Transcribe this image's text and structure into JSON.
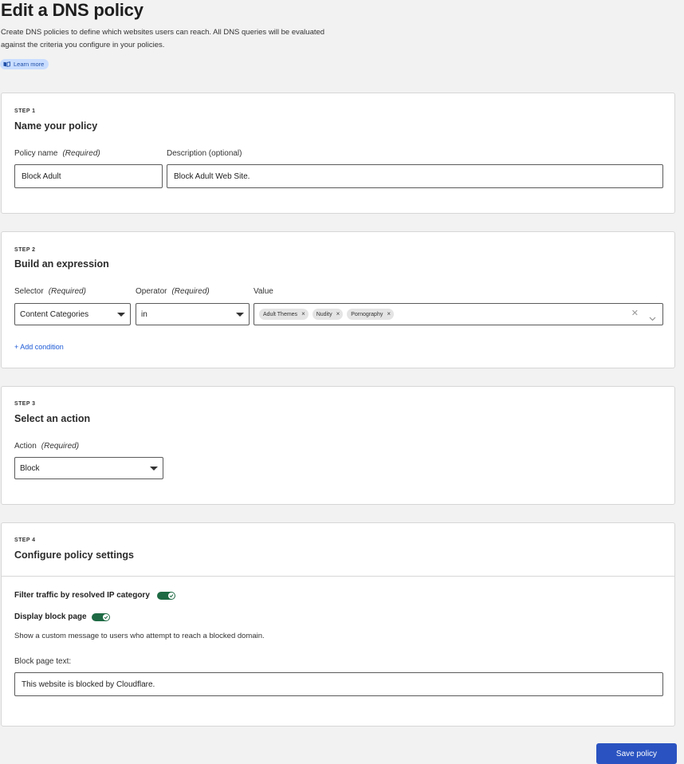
{
  "page": {
    "title": "Edit a DNS policy",
    "description": "Create DNS policies to define which websites users can reach. All DNS queries will be evaluated against the criteria you configure in your policies.",
    "learn_more": "Learn more"
  },
  "step1": {
    "label": "STEP 1",
    "title": "Name your policy",
    "policy_name_label": "Policy name",
    "policy_name_req": "(Required)",
    "policy_name_value": "Block Adult",
    "description_label": "Description (optional)",
    "description_value": "Block Adult Web Site."
  },
  "step2": {
    "label": "STEP 2",
    "title": "Build an expression",
    "selector_label": "Selector",
    "selector_req": "(Required)",
    "selector_value": "Content Categories",
    "operator_label": "Operator",
    "operator_req": "(Required)",
    "operator_value": "in",
    "value_label": "Value",
    "values": [
      "Adult Themes",
      "Nudity",
      "Pornography"
    ],
    "add_condition": "+ Add condition"
  },
  "step3": {
    "label": "STEP 3",
    "title": "Select an action",
    "action_label": "Action",
    "action_req": "(Required)",
    "action_value": "Block"
  },
  "step4": {
    "label": "STEP 4",
    "title": "Configure policy settings",
    "filter_ip_label": "Filter traffic by resolved IP category",
    "filter_ip_on": true,
    "block_page_label": "Display block page",
    "block_page_on": true,
    "help_text": "Show a custom message to users who attempt to reach a blocked domain.",
    "block_text_label": "Block page text:",
    "block_text_value": "This website is blocked by Cloudflare."
  },
  "footer": {
    "save_label": "Save policy"
  },
  "colors": {
    "toggle_on": "#1e6a44",
    "primary": "#2a53c1",
    "link": "#1d5ad6",
    "chip_bg": "#e4e4e4",
    "learn_more_bg": "#c9ddff"
  }
}
